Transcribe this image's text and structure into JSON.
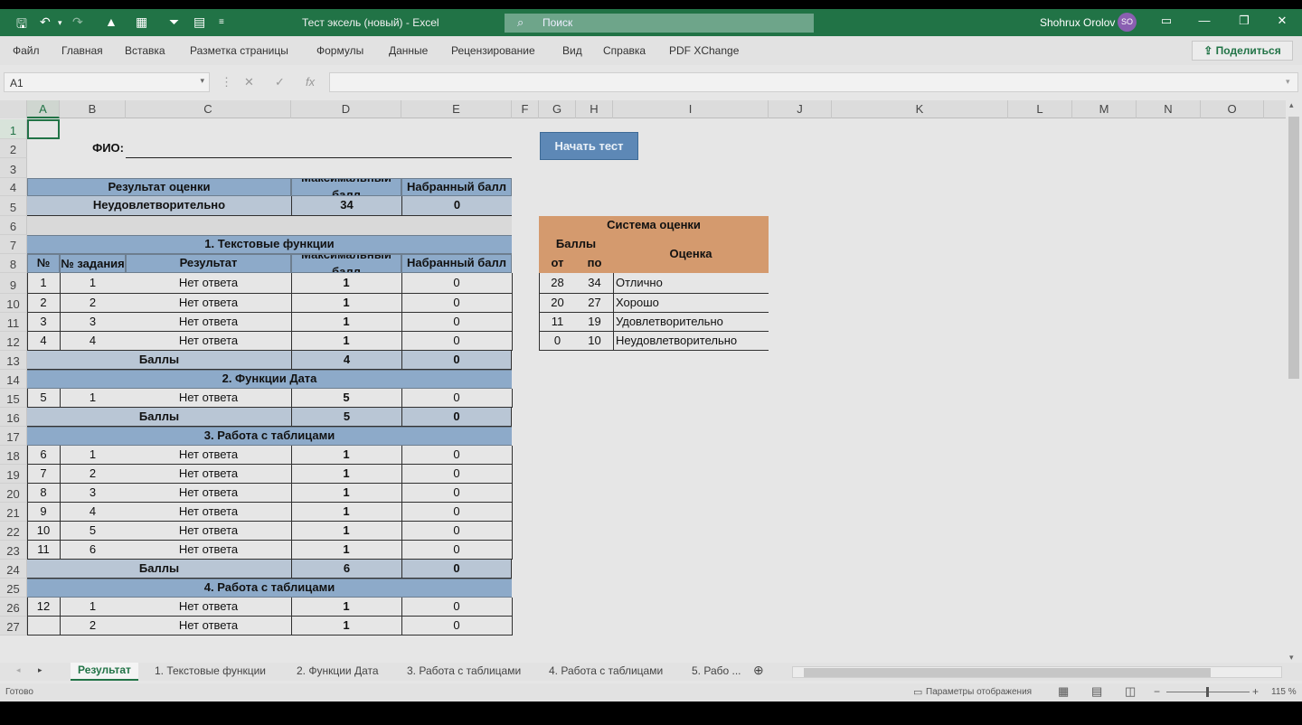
{
  "titlebar": {
    "doc_title": "Тест эксель (новый)  -  Excel",
    "search_placeholder": "Поиск",
    "user_name": "Shohrux Orolov",
    "avatar_initials": "SO",
    "accent": "#217346"
  },
  "menu": {
    "items": [
      "Файл",
      "Главная",
      "Вставка",
      "Разметка страницы",
      "Формулы",
      "Данные",
      "Рецензирование",
      "Вид",
      "Справка",
      "PDF XChange"
    ],
    "share_label": "Поделиться"
  },
  "formula_bar": {
    "name_box": "A1",
    "fx": "fx",
    "content": ""
  },
  "columns": [
    "A",
    "B",
    "C",
    "D",
    "E",
    "F",
    "G",
    "H",
    "I",
    "J",
    "K",
    "L",
    "M",
    "N",
    "O"
  ],
  "rows": [
    "1",
    "2",
    "3",
    "4",
    "5",
    "6",
    "7",
    "8",
    "9",
    "10",
    "11",
    "12",
    "13",
    "14",
    "15",
    "16",
    "17",
    "18",
    "19",
    "20",
    "21",
    "22",
    "23",
    "24",
    "25",
    "26",
    "27"
  ],
  "sheet": {
    "fio_label": "ФИО:",
    "start_button": "Начать тест",
    "result_header": "Результат оценки",
    "max_header": "Максимальный балл",
    "got_header": "Набранный балл",
    "result_value": "Неудовлетворительно",
    "result_max": "34",
    "result_got": "0",
    "col_num": "№",
    "col_task": "№ задания",
    "col_result": "Результат",
    "balls_label": "Баллы",
    "sections": [
      {
        "title": "1. Текстовые функции",
        "rows": [
          [
            "1",
            "1",
            "Нет ответа",
            "1",
            "0"
          ],
          [
            "2",
            "2",
            "Нет ответа",
            "1",
            "0"
          ],
          [
            "3",
            "3",
            "Нет ответа",
            "1",
            "0"
          ],
          [
            "4",
            "4",
            "Нет ответа",
            "1",
            "0"
          ]
        ],
        "total_max": "4",
        "total_got": "0"
      },
      {
        "title": "2. Функции Дата",
        "rows": [
          [
            "5",
            "1",
            "Нет ответа",
            "5",
            "0"
          ]
        ],
        "total_max": "5",
        "total_got": "0"
      },
      {
        "title": "3. Работа с таблицами",
        "rows": [
          [
            "6",
            "1",
            "Нет ответа",
            "1",
            "0"
          ],
          [
            "7",
            "2",
            "Нет ответа",
            "1",
            "0"
          ],
          [
            "8",
            "3",
            "Нет ответа",
            "1",
            "0"
          ],
          [
            "9",
            "4",
            "Нет ответа",
            "1",
            "0"
          ],
          [
            "10",
            "5",
            "Нет ответа",
            "1",
            "0"
          ],
          [
            "11",
            "6",
            "Нет ответа",
            "1",
            "0"
          ]
        ],
        "total_max": "6",
        "total_got": "0"
      },
      {
        "title": "4. Работа с таблицами",
        "rows": [
          [
            "12",
            "1",
            "Нет ответа",
            "1",
            "0"
          ],
          [
            "",
            "2",
            "Нет ответа",
            "1",
            "0"
          ]
        ]
      }
    ],
    "grading": {
      "title": "Система оценки",
      "points": "Баллы",
      "from": "от",
      "to": "по",
      "grade": "Оценка",
      "rows": [
        [
          "28",
          "34",
          "Отлично"
        ],
        [
          "20",
          "27",
          "Хорошо"
        ],
        [
          "11",
          "19",
          "Удовлетворительно"
        ],
        [
          "0",
          "10",
          "Неудовлетворительно"
        ]
      ]
    }
  },
  "tabs": [
    "Результат",
    "1. Текстовые функции",
    "2. Функции Дата",
    "3. Работа с таблицами",
    "4. Работа с таблицами",
    "5. Рабо ..."
  ],
  "status": {
    "ready": "Готово",
    "display_settings": "Параметры отображения",
    "zoom": "115 %"
  }
}
